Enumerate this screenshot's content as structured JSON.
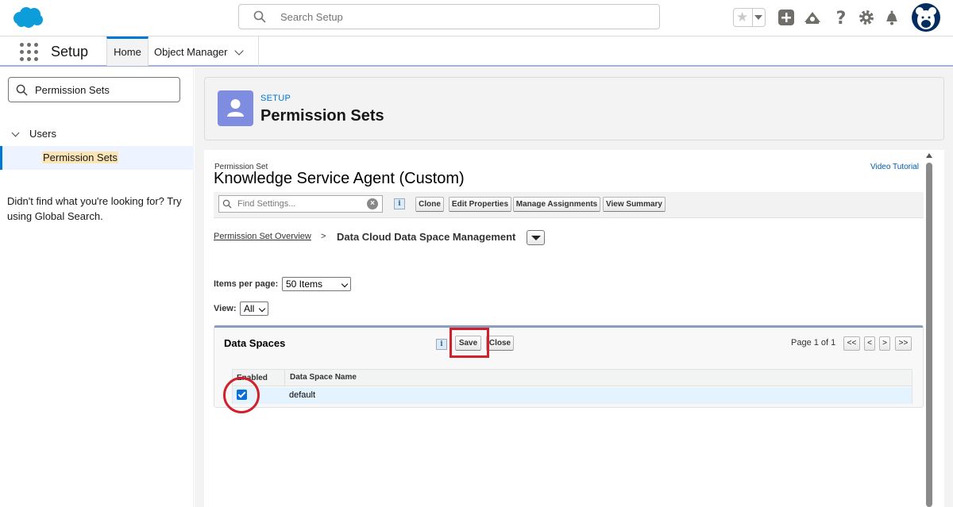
{
  "global_header": {
    "search_placeholder": "Search Setup",
    "icons": [
      "salesforce-cloud-logo",
      "favorites-star-icon",
      "add-icon",
      "trailhead-icon",
      "help-icon",
      "gear-icon",
      "notifications-bell-icon",
      "user-avatar"
    ]
  },
  "app_bar": {
    "app_name": "Setup",
    "tabs": [
      {
        "label": "Home",
        "active": true
      },
      {
        "label": "Object Manager",
        "active": false
      }
    ]
  },
  "sidebar": {
    "quick_find_value": "Permission Sets",
    "tree": {
      "group_label": "Users",
      "item_label": "Permission Sets"
    },
    "help_text": "Didn't find what you're looking for? Try using Global Search."
  },
  "page_header": {
    "eyebrow": "SETUP",
    "title": "Permission Sets"
  },
  "permission_set": {
    "label": "Permission Set",
    "name": "Knowledge Service Agent (Custom)",
    "video_tutorial": "Video Tutorial"
  },
  "toolbar": {
    "find_placeholder": "Find Settings...",
    "info": "i",
    "buttons": [
      "Clone",
      "Edit Properties",
      "Manage Assignments",
      "View Summary"
    ]
  },
  "breadcrumb": {
    "overview": "Permission Set Overview",
    "separator": ">",
    "current": "Data Cloud Data Space Management"
  },
  "filters": {
    "items_per_page_label": "Items per page:",
    "items_per_page_value": "50 Items",
    "view_label": "View:",
    "view_value": "All"
  },
  "data_spaces": {
    "title": "Data Spaces",
    "info": "i",
    "save_label": "Save",
    "close_label": "Close",
    "page_text": "Page 1 of 1",
    "nav": [
      "<<",
      "<",
      ">",
      ">>"
    ],
    "columns": [
      "Enabled",
      "Data Space Name"
    ],
    "rows": [
      {
        "enabled": true,
        "name": "default"
      }
    ]
  },
  "colors": {
    "accent": "#0176d3",
    "annotation_red": "#d0202a",
    "header_icon_bg": "#7f8de1"
  }
}
